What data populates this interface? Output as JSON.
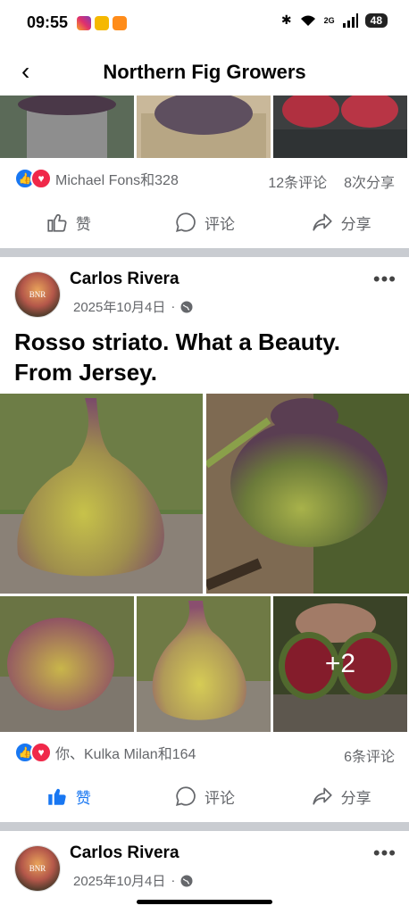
{
  "status_bar": {
    "time": "09:55",
    "signal_label": "2G",
    "battery": "48"
  },
  "header": {
    "back": "‹",
    "title": "Northern Fig Growers"
  },
  "post1": {
    "reactors": "Michael Fons和328",
    "comments": "12条评论",
    "shares": "8次分享"
  },
  "post2": {
    "author": "Carlos Rivera",
    "date": "2025年10月4日",
    "text": "Rosso striato. What a Beauty. From Jersey.",
    "more_photos": "+2",
    "reactors": "你、Kulka Milan和164",
    "comments": "6条评论"
  },
  "post3": {
    "author": "Carlos Rivera",
    "date": "2025年10月4日"
  },
  "actions": {
    "like": "赞",
    "comment": "评论",
    "share": "分享"
  },
  "avatar_text": "BNR",
  "colors": {
    "accent": "#1877f2",
    "love": "#f02849",
    "divider": "#c9ccd1"
  }
}
